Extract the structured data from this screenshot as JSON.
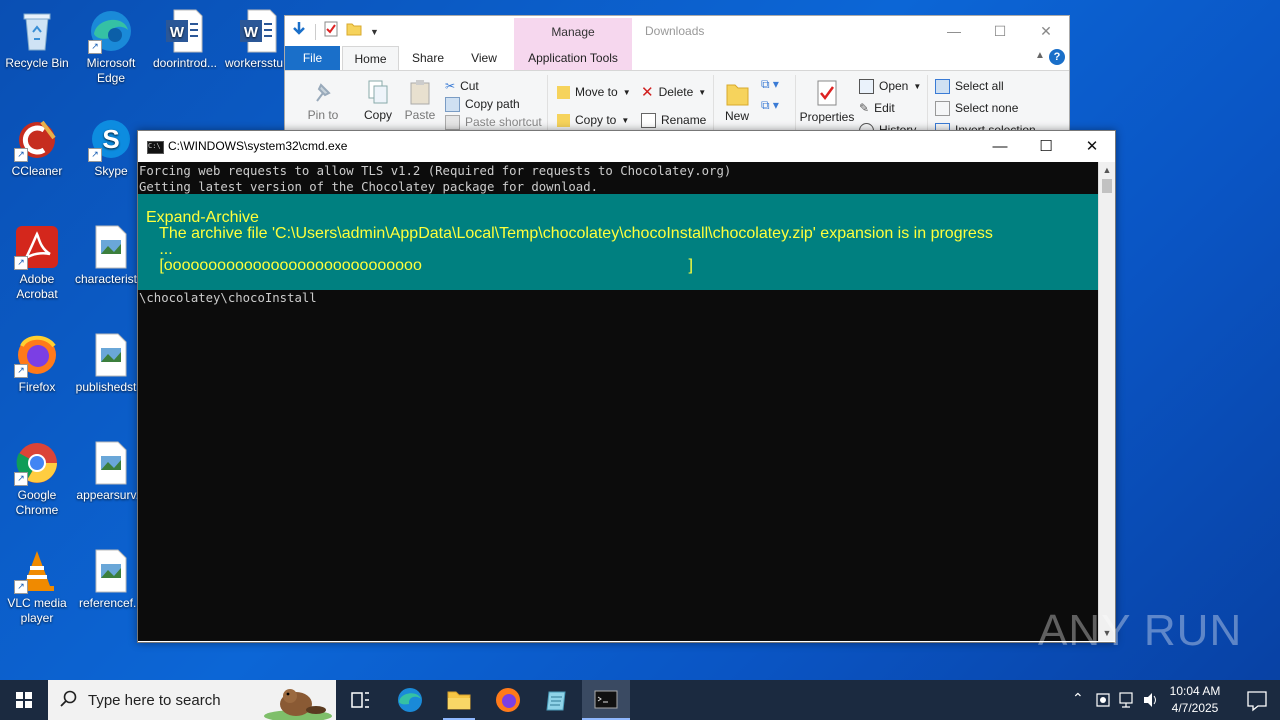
{
  "desktop": {
    "icons": [
      {
        "label": "Recycle Bin"
      },
      {
        "label": "Microsoft Edge"
      },
      {
        "label": "doorintrod..."
      },
      {
        "label": "workersstu..."
      },
      {
        "label": "CCleaner"
      },
      {
        "label": "Skype"
      },
      {
        "label": "Adobe Acrobat"
      },
      {
        "label": "characterist..."
      },
      {
        "label": "Firefox"
      },
      {
        "label": "publishedst..."
      },
      {
        "label": "Google Chrome"
      },
      {
        "label": "appearsurv..."
      },
      {
        "label": "VLC media player"
      },
      {
        "label": "referencef..."
      }
    ]
  },
  "explorer": {
    "title": "Downloads",
    "manage_label": "Manage",
    "tabs": {
      "file": "File",
      "home": "Home",
      "share": "Share",
      "view": "View",
      "app_tools": "Application Tools"
    },
    "ribbon": {
      "pin": "Pin to Quick access",
      "copy": "Copy",
      "paste": "Paste",
      "cut": "Cut",
      "copy_path": "Copy path",
      "paste_shortcut": "Paste shortcut",
      "move_to": "Move to",
      "copy_to": "Copy to",
      "delete": "Delete",
      "rename": "Rename",
      "new_folder": "New folder",
      "properties": "Properties",
      "open": "Open",
      "edit": "Edit",
      "history": "History",
      "select_all": "Select all",
      "select_none": "Select none",
      "invert_selection": "Invert selection"
    }
  },
  "cmd": {
    "title": "C:\\WINDOWS\\system32\\cmd.exe",
    "lines": [
      "Forcing web requests to allow TLS v1.2 (Required for requests to Chocolatey.org)",
      "Getting latest version of the Chocolatey package for download."
    ],
    "progress": {
      "activity": "Expand-Archive",
      "status": "   The archive file 'C:\\Users\\admin\\AppData\\Local\\Temp\\chocolatey\\chocoInstall\\chocolatey.zip' expansion is in progress",
      "ellipsis": "   ...",
      "bar": "   [ooooooooooooooooooooooooooooo                                                            ]"
    },
    "after_line": "\\chocolatey\\chocoInstall"
  },
  "watermark": "ANY RUN",
  "taskbar": {
    "search_placeholder": "Type here to search",
    "time": "10:04 AM",
    "date": "4/7/2025"
  },
  "colors": {
    "desktop": "#0c66d6",
    "console_bg": "#0c0c0c",
    "progress_bg": "#008080",
    "progress_fg": "#ffff3c",
    "taskbar": "#1b2a40"
  }
}
